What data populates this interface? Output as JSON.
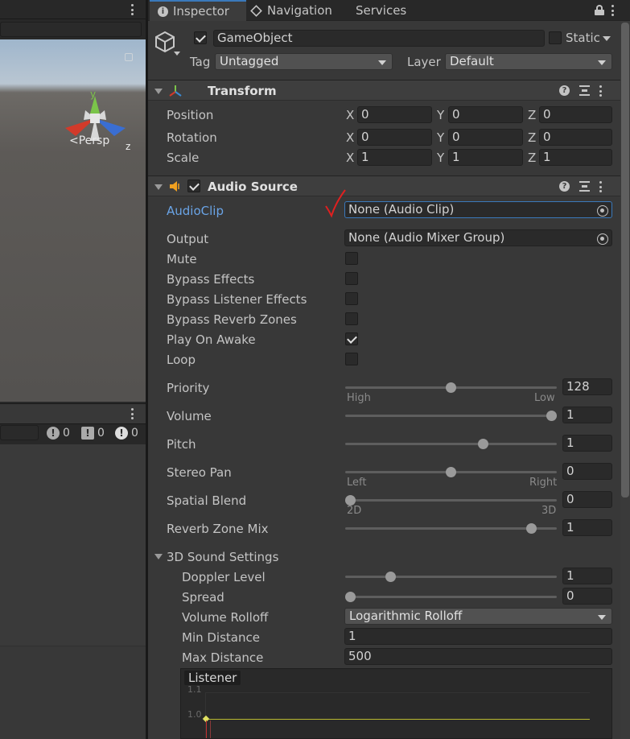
{
  "scene": {
    "persp_label": "<Persp",
    "axis_x": "x",
    "axis_y": "y",
    "axis_z": "z"
  },
  "console": {
    "counts": [
      {
        "icon": "info-icon",
        "value": "0"
      },
      {
        "icon": "warning-icon",
        "value": "0"
      },
      {
        "icon": "error-icon",
        "value": "0"
      }
    ]
  },
  "tabs": [
    {
      "label": "Inspector",
      "icon": "info-icon",
      "active": true
    },
    {
      "label": "Navigation",
      "icon": "navigation-icon",
      "active": false
    },
    {
      "label": "Services",
      "active": false
    }
  ],
  "header": {
    "name": "GameObject",
    "active": true,
    "static_label": "Static",
    "static": false,
    "tag_label": "Tag",
    "tag_value": "Untagged",
    "layer_label": "Layer",
    "layer_value": "Default"
  },
  "transform": {
    "title": "Transform",
    "rows": [
      {
        "label": "Position",
        "x": "0",
        "y": "0",
        "z": "0"
      },
      {
        "label": "Rotation",
        "x": "0",
        "y": "0",
        "z": "0"
      },
      {
        "label": "Scale",
        "x": "1",
        "y": "1",
        "z": "1"
      }
    ],
    "axis": {
      "x": "X",
      "y": "Y",
      "z": "Z"
    }
  },
  "audio": {
    "title": "Audio Source",
    "enabled": true,
    "clip_label": "AudioClip",
    "clip_value": "None (Audio Clip)",
    "output_label": "Output",
    "output_value": "None (Audio Mixer Group)",
    "checks": [
      {
        "label": "Mute",
        "checked": false
      },
      {
        "label": "Bypass Effects",
        "checked": false
      },
      {
        "label": "Bypass Listener Effects",
        "checked": false
      },
      {
        "label": "Bypass Reverb Zones",
        "checked": false
      },
      {
        "label": "Play On Awake",
        "checked": true
      },
      {
        "label": "Loop",
        "checked": false
      }
    ],
    "sliders": [
      {
        "label": "Priority",
        "value": "128",
        "fraction": 0.5,
        "min_label": "High",
        "max_label": "Low"
      },
      {
        "label": "Volume",
        "value": "1",
        "fraction": 1.0
      },
      {
        "label": "Pitch",
        "value": "1",
        "fraction": 0.66
      },
      {
        "label": "Stereo Pan",
        "value": "0",
        "fraction": 0.5,
        "min_label": "Left",
        "max_label": "Right"
      },
      {
        "label": "Spatial Blend",
        "value": "0",
        "fraction": 0.0,
        "min_label": "2D",
        "max_label": "3D"
      },
      {
        "label": "Reverb Zone Mix",
        "value": "1",
        "fraction": 0.9
      }
    ],
    "sound3d": {
      "title": "3D Sound Settings",
      "doppler_label": "Doppler Level",
      "doppler_value": "1",
      "doppler_fraction": 0.2,
      "spread_label": "Spread",
      "spread_value": "0",
      "spread_fraction": 0.0,
      "rolloff_label": "Volume Rolloff",
      "rolloff_value": "Logarithmic Rolloff",
      "min_label": "Min Distance",
      "min_value": "1",
      "max_label": "Max Distance",
      "max_value": "500",
      "graph_title": "Listener",
      "graph_ticks": [
        "1.1",
        "1.0"
      ]
    }
  }
}
